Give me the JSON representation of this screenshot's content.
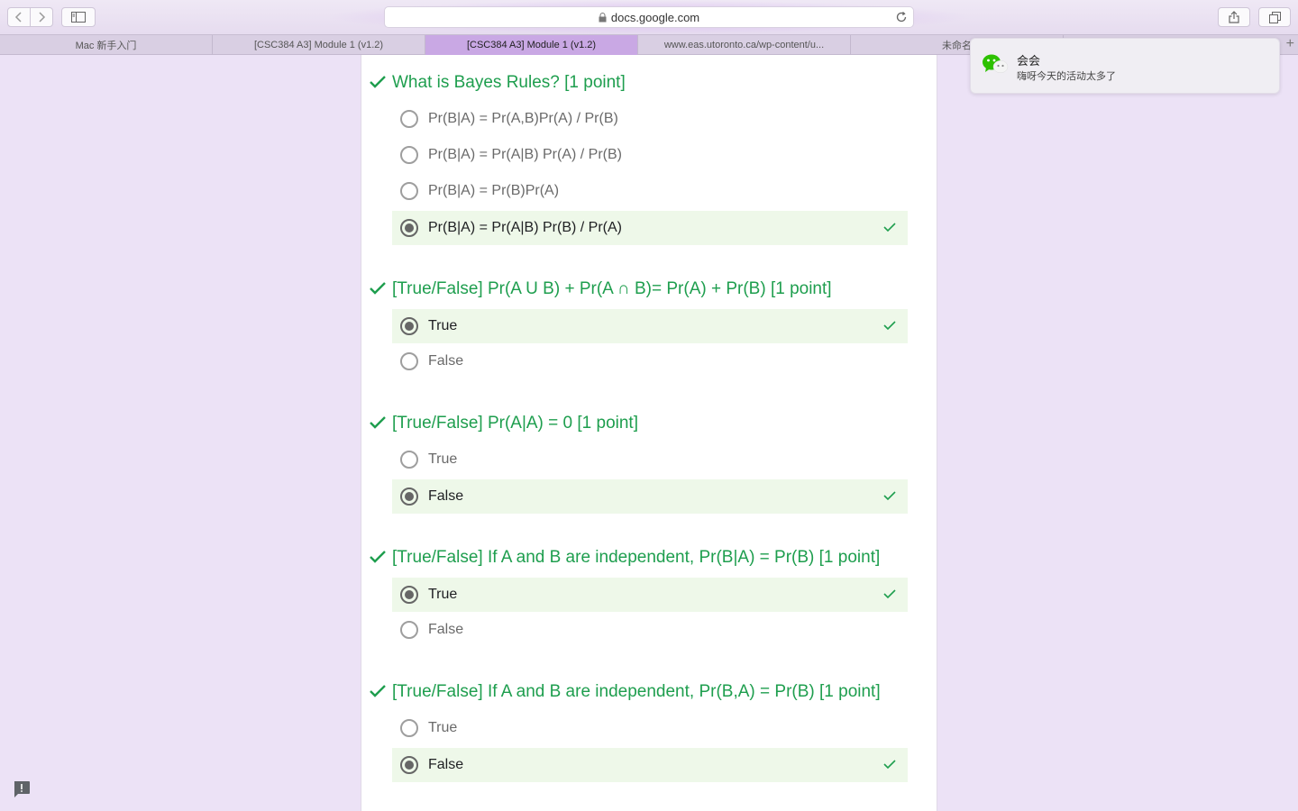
{
  "browser": {
    "url": "docs.google.com",
    "tabs": [
      {
        "label": "Mac 新手入门",
        "active": false
      },
      {
        "label": "[CSC384 A3] Module 1 (v1.2)",
        "active": false
      },
      {
        "label": "[CSC384 A3] Module 1 (v1.2)",
        "active": true
      },
      {
        "label": "www.eas.utoronto.ca/wp-content/u...",
        "active": false
      },
      {
        "label": "未命名",
        "active": false
      }
    ],
    "new_tab_label": "+"
  },
  "notification": {
    "app_icon": "wechat-icon",
    "title": "会会",
    "body": "嗨呀今天的活动太多了"
  },
  "colors": {
    "correct_green": "#1e9e4e",
    "correct_bg": "#eef8e9",
    "accent_purple": "#c9a8e4"
  },
  "questions": [
    {
      "title": "What is Bayes Rules? [1 point]",
      "options": [
        {
          "label": "Pr(B|A) = Pr(A,B)Pr(A) / Pr(B)",
          "selected": false,
          "correct": false
        },
        {
          "label": "Pr(B|A) = Pr(A|B) Pr(A) / Pr(B)",
          "selected": false,
          "correct": false
        },
        {
          "label": "Pr(B|A) = Pr(B)Pr(A)",
          "selected": false,
          "correct": false
        },
        {
          "label": "Pr(B|A) = Pr(A|B) Pr(B) / Pr(A)",
          "selected": true,
          "correct": true
        }
      ]
    },
    {
      "title": "[True/False] Pr(A U B) + Pr(A ∩ B)= Pr(A) + Pr(B) [1 point]",
      "options": [
        {
          "label": "True",
          "selected": true,
          "correct": true
        },
        {
          "label": "False",
          "selected": false,
          "correct": false
        }
      ]
    },
    {
      "title": "[True/False] Pr(A|A) = 0 [1 point]",
      "options": [
        {
          "label": "True",
          "selected": false,
          "correct": false
        },
        {
          "label": "False",
          "selected": true,
          "correct": true
        }
      ]
    },
    {
      "title": "[True/False] If A and B are independent, Pr(B|A) = Pr(B) [1 point]",
      "options": [
        {
          "label": "True",
          "selected": true,
          "correct": true
        },
        {
          "label": "False",
          "selected": false,
          "correct": false
        }
      ]
    },
    {
      "title": "[True/False] If A and B are independent, Pr(B,A) = Pr(B) [1 point]",
      "options": [
        {
          "label": "True",
          "selected": false,
          "correct": false
        },
        {
          "label": "False",
          "selected": true,
          "correct": true
        }
      ]
    }
  ]
}
